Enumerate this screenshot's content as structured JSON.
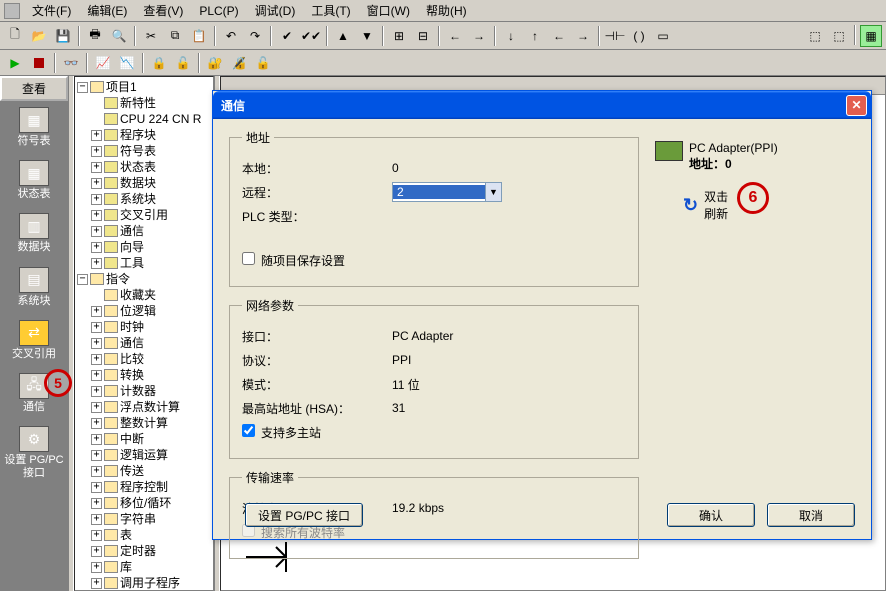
{
  "menu": {
    "file": "文件(F)",
    "edit": "编辑(E)",
    "view": "查看(V)",
    "plc": "PLC(P)",
    "debug": "调试(D)",
    "tools": "工具(T)",
    "window": "窗口(W)",
    "help": "帮助(H)"
  },
  "sidebar": {
    "header": "查看",
    "items": [
      {
        "label": "符号表"
      },
      {
        "label": "状态表"
      },
      {
        "label": "数据块"
      },
      {
        "label": "系统块"
      },
      {
        "label": "交叉引用"
      },
      {
        "label": "通信"
      },
      {
        "label": "设置 PG/PC 接口"
      }
    ],
    "marker5": "5"
  },
  "tree": {
    "root": "项目1",
    "nodes": [
      "新特性",
      "CPU 224 CN R",
      "程序块",
      "符号表",
      "状态表",
      "数据块",
      "系统块",
      "交叉引用",
      "通信",
      "向导",
      "工具"
    ],
    "cmd_root": "指令",
    "cmds": [
      "收藏夹",
      "位逻辑",
      "时钟",
      "通信",
      "比较",
      "转换",
      "计数器",
      "浮点数计算",
      "整数计算",
      "中断",
      "逻辑运算",
      "传送",
      "程序控制",
      "移位/循环",
      "字符串",
      "表",
      "定时器",
      "库",
      "调用子程序"
    ]
  },
  "dialog": {
    "title": "通信",
    "group_addr": "地址",
    "local": "本地：",
    "local_val": "0",
    "remote": "远程：",
    "remote_val": "2",
    "plc_type": "PLC 类型：",
    "save_with_project": "随项目保存设置",
    "group_net": "网络参数",
    "iface": "接口：",
    "iface_val": "PC Adapter",
    "proto": "协议：",
    "proto_val": "PPI",
    "mode": "模式：",
    "mode_val": "11 位",
    "hsa": "最高站地址 (HSA)：",
    "hsa_val": "31",
    "multi_master": "支持多主站",
    "group_rate": "传输速率",
    "baud": "波特率",
    "baud_val": "19.2 kbps",
    "search_all": "搜索所有波特率",
    "adapter_name": "PC Adapter(PPI)",
    "adapter_addr": "地址：0",
    "refresh_l1": "双击",
    "refresh_l2": "刷新",
    "marker6": "6",
    "btn_setpg": "设置 PG/PC 接口",
    "btn_ok": "确认",
    "btn_cancel": "取消"
  }
}
